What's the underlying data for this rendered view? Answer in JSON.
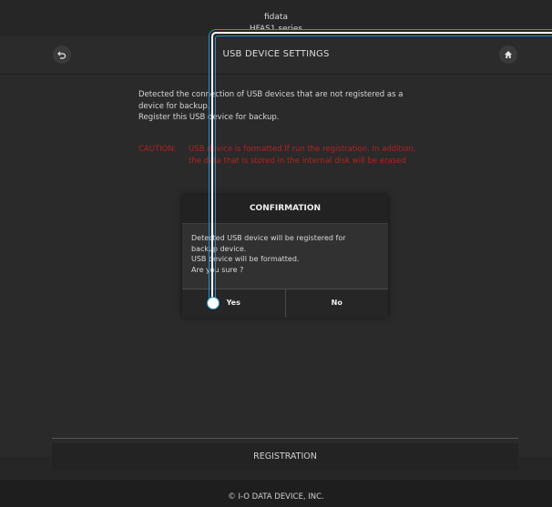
{
  "header": {
    "brand_line1": "fidata",
    "brand_line2": "HFAS1 series"
  },
  "nav": {
    "title": "USB DEVICE SETTINGS",
    "back_icon": "back-arrow-icon",
    "home_icon": "home-icon"
  },
  "main": {
    "message_lines": [
      "Detected the connection of USB devices that are not registered as a",
      "device for backup.",
      "Register this USB device for backup."
    ],
    "caution_label": "CAUTION:",
    "caution_lines": [
      "USB device is formatted If run the registration. In addition,",
      "the data that is stored in the internal disk will be erased"
    ],
    "caution_color": "#b22222"
  },
  "dialog": {
    "title": "CONFIRMATION",
    "body_lines": [
      "Detected USB device will be registered for",
      "backup device.",
      "USB device will be formatted.",
      "Are you sure ?"
    ],
    "yes_label": "Yes",
    "no_label": "No"
  },
  "registration": {
    "button_label": "REGISTRATION"
  },
  "footer": {
    "copyright": "© I-O DATA DEVICE, INC."
  }
}
